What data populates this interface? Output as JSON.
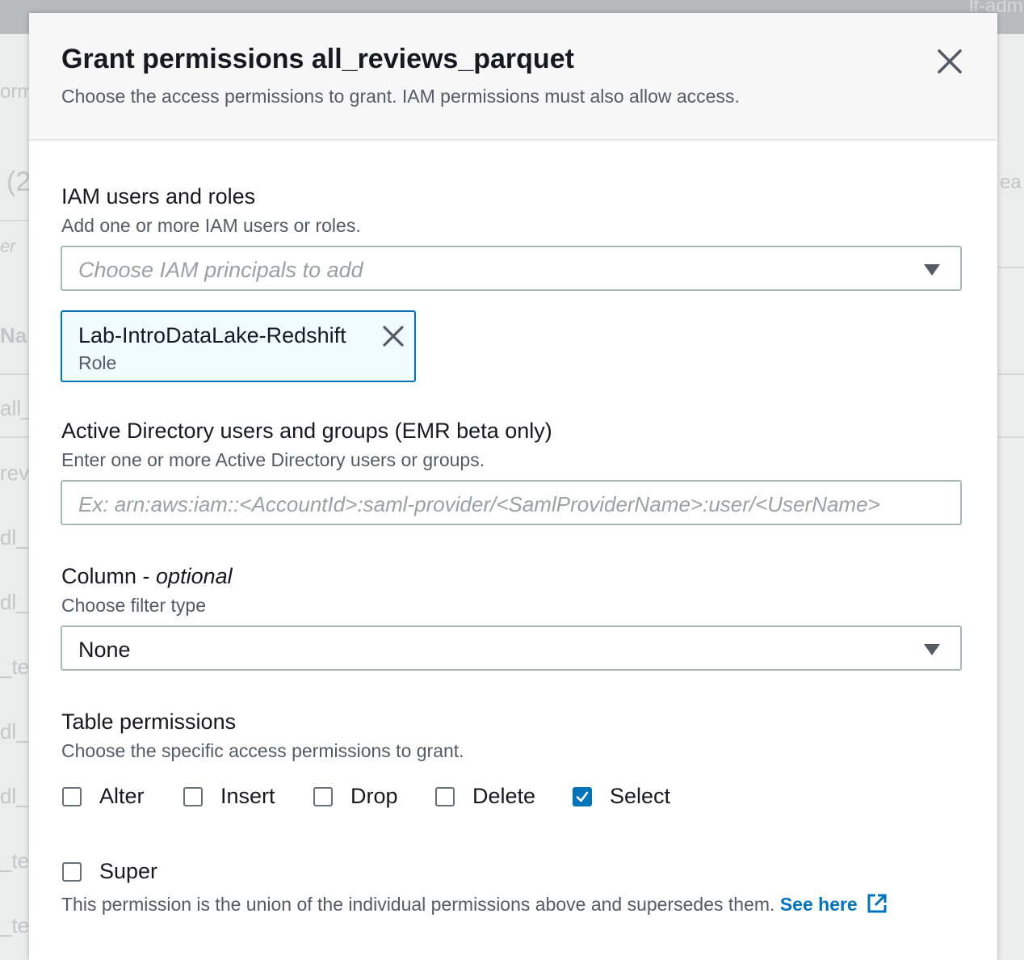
{
  "modal": {
    "title": "Grant permissions all_reviews_parquet",
    "subtitle": "Choose the access permissions to grant. IAM permissions must also allow access.",
    "close_icon": "close-icon"
  },
  "iam": {
    "label": "IAM users and roles",
    "description": "Add one or more IAM users or roles.",
    "placeholder": "Choose IAM principals to add",
    "token": {
      "name": "Lab-IntroDataLake-Redshift",
      "type": "Role",
      "remove_icon": "close-icon"
    }
  },
  "ad": {
    "label": "Active Directory users and groups (EMR beta only)",
    "description": "Enter one or more Active Directory users or groups.",
    "placeholder": "Ex: arn:aws:iam::<AccountId>:saml-provider/<SamlProviderName>:user/<UserName>"
  },
  "column": {
    "label": "Column - ",
    "label_optional": "optional",
    "description": "Choose filter type",
    "selected": "None"
  },
  "table_permissions": {
    "label": "Table permissions",
    "description": "Choose the specific access permissions to grant.",
    "options": [
      {
        "label": "Alter",
        "checked": false
      },
      {
        "label": "Insert",
        "checked": false
      },
      {
        "label": "Drop",
        "checked": false
      },
      {
        "label": "Delete",
        "checked": false
      },
      {
        "label": "Select",
        "checked": true
      }
    ],
    "super": {
      "label": "Super",
      "checked": false,
      "description": "This permission is the union of the individual permissions above and supersedes them.",
      "link_text": "See here",
      "link_icon": "external-link-icon"
    }
  },
  "colors": {
    "accent": "#0073bb",
    "border": "#aab7b8",
    "text": "#16191f",
    "muted": "#545b64"
  },
  "background": {
    "fragments": [
      "orm",
      "(2",
      "er",
      "Na",
      "all_",
      "rev",
      "dl_",
      "dl_",
      "_te",
      "dl_",
      "dl_",
      "_te",
      "_te",
      "ea",
      "lf-adm"
    ]
  }
}
